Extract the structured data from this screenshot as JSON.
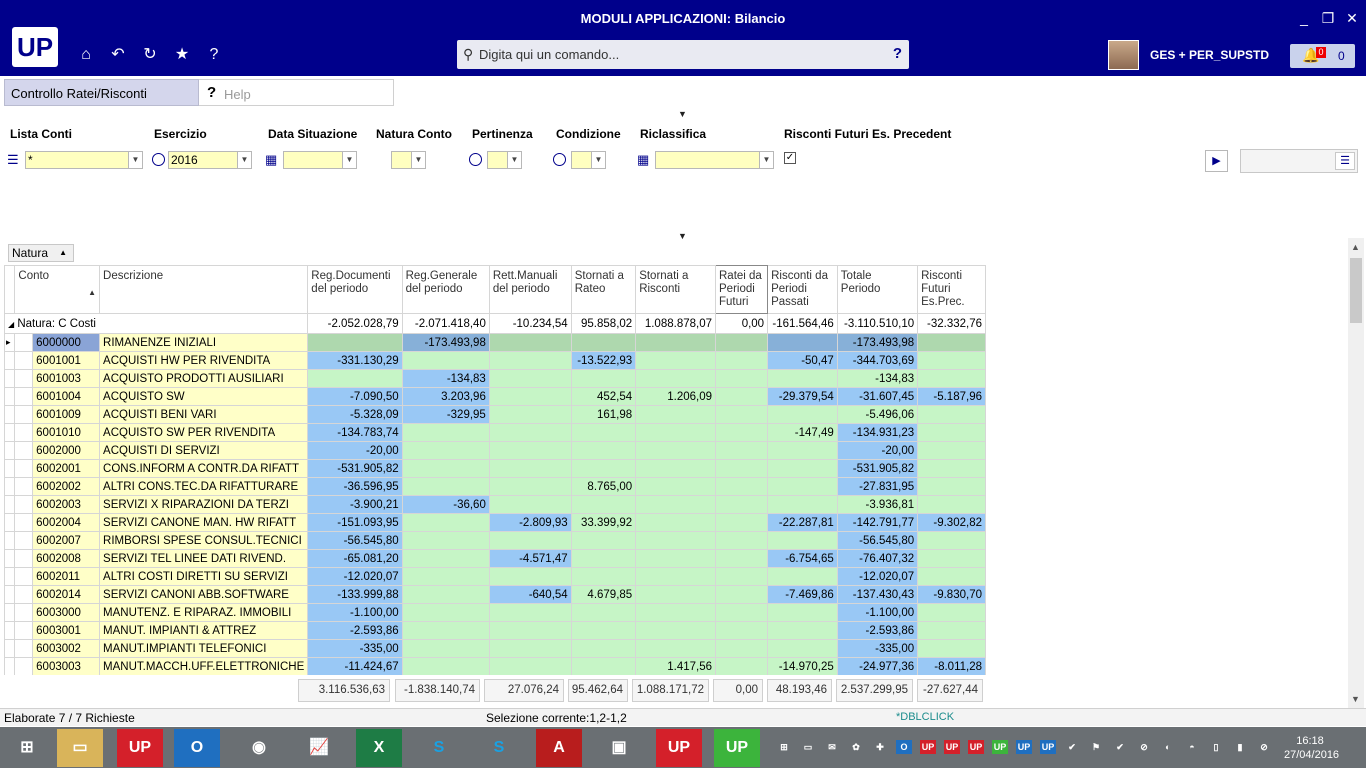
{
  "window": {
    "title": "MODULI APPLICAZIONI: Bilancio",
    "min": "_",
    "max": "❐",
    "close": "✕"
  },
  "header": {
    "logo": "UP",
    "search_placeholder": "Digita qui un comando...",
    "help": "?",
    "user": "GES + PER_SUPSTD",
    "notif_badge": "0",
    "notif_count": "0"
  },
  "tabs": [
    {
      "label": "Controllo Ratei/Risconti"
    },
    {
      "label": "Help"
    }
  ],
  "filters": {
    "lista_conti": {
      "label": "Lista Conti",
      "value": "*"
    },
    "esercizio": {
      "label": "Esercizio",
      "value": "2016"
    },
    "data_situazione": {
      "label": "Data Situazione",
      "value": ""
    },
    "natura_conto": {
      "label": "Natura Conto",
      "value": ""
    },
    "pertinenza": {
      "label": "Pertinenza",
      "value": ""
    },
    "condizione": {
      "label": "Condizione",
      "value": ""
    },
    "riclassifica": {
      "label": "Riclassifica",
      "value": ""
    },
    "risconti_futuri": {
      "label": "Risconti Futuri Es. Precedent",
      "checked": "✓"
    }
  },
  "grouping": {
    "label": "Natura"
  },
  "grid": {
    "columns": [
      "Conto",
      "Descrizione",
      "Reg.Documenti del periodo",
      "Reg.Generale del periodo",
      "Rett.Manuali del periodo",
      "Stornati a Rateo",
      "Stornati a Risconti",
      "Ratei da Periodi Futuri",
      "Risconti da Periodi Passati",
      "Totale Periodo",
      "Risconti Futuri Es.Prec."
    ],
    "group_row": {
      "label": "Natura: C Costi",
      "values": [
        "-2.052.028,79",
        "-2.071.418,40",
        "-10.234,54",
        "95.858,02",
        "1.088.878,07",
        "0,00",
        "-161.564,46",
        "-3.110.510,10",
        "-32.332,76"
      ]
    },
    "rows": [
      {
        "conto": "6000000",
        "descr": "RIMANENZE INIZIALI",
        "v": [
          "",
          "-173.493,98",
          "",
          "",
          "",
          "",
          "",
          "-173.493,98",
          ""
        ]
      },
      {
        "conto": "6001001",
        "descr": "ACQUISTI HW PER RIVENDITA",
        "v": [
          "-331.130,29",
          "",
          "",
          "-13.522,93",
          "",
          "",
          "-50,47",
          "-344.703,69",
          ""
        ]
      },
      {
        "conto": "6001003",
        "descr": "ACQUISTO PRODOTTI AUSILIARI",
        "v": [
          "",
          "-134,83",
          "",
          "",
          "",
          "",
          "",
          "-134,83",
          ""
        ]
      },
      {
        "conto": "6001004",
        "descr": "ACQUISTO SW",
        "v": [
          "-7.090,50",
          "3.203,96",
          "",
          "452,54",
          "1.206,09",
          "",
          "-29.379,54",
          "-31.607,45",
          "-5.187,96"
        ]
      },
      {
        "conto": "6001009",
        "descr": "ACQUISTI BENI VARI",
        "v": [
          "-5.328,09",
          "-329,95",
          "",
          "161,98",
          "",
          "",
          "",
          "-5.496,06",
          ""
        ]
      },
      {
        "conto": "6001010",
        "descr": "ACQUISTO SW PER RIVENDITA",
        "v": [
          "-134.783,74",
          "",
          "",
          "",
          "",
          "",
          "-147,49",
          "-134.931,23",
          ""
        ]
      },
      {
        "conto": "6002000",
        "descr": "ACQUISTI DI SERVIZI",
        "v": [
          "-20,00",
          "",
          "",
          "",
          "",
          "",
          "",
          "-20,00",
          ""
        ]
      },
      {
        "conto": "6002001",
        "descr": "CONS.INFORM A CONTR.DA RIFATT",
        "v": [
          "-531.905,82",
          "",
          "",
          "",
          "",
          "",
          "",
          "-531.905,82",
          ""
        ]
      },
      {
        "conto": "6002002",
        "descr": "ALTRI CONS.TEC.DA RIFATTURARE",
        "v": [
          "-36.596,95",
          "",
          "",
          "8.765,00",
          "",
          "",
          "",
          "-27.831,95",
          ""
        ]
      },
      {
        "conto": "6002003",
        "descr": "SERVIZI X RIPARAZIONI DA TERZI",
        "v": [
          "-3.900,21",
          "-36,60",
          "",
          "",
          "",
          "",
          "",
          "-3.936,81",
          ""
        ]
      },
      {
        "conto": "6002004",
        "descr": "SERVIZI CANONE MAN. HW RIFATT",
        "v": [
          "-151.093,95",
          "",
          "-2.809,93",
          "33.399,92",
          "",
          "",
          "-22.287,81",
          "-142.791,77",
          "-9.302,82"
        ]
      },
      {
        "conto": "6002007",
        "descr": "RIMBORSI SPESE CONSUL.TECNICI",
        "v": [
          "-56.545,80",
          "",
          "",
          "",
          "",
          "",
          "",
          "-56.545,80",
          ""
        ]
      },
      {
        "conto": "6002008",
        "descr": "SERVIZI TEL LINEE DATI RIVEND.",
        "v": [
          "-65.081,20",
          "",
          "-4.571,47",
          "",
          "",
          "",
          "-6.754,65",
          "-76.407,32",
          ""
        ]
      },
      {
        "conto": "6002011",
        "descr": "ALTRI COSTI DIRETTI SU SERVIZI",
        "v": [
          "-12.020,07",
          "",
          "",
          "",
          "",
          "",
          "",
          "-12.020,07",
          ""
        ]
      },
      {
        "conto": "6002014",
        "descr": "SERVIZI CANONI ABB.SOFTWARE",
        "v": [
          "-133.999,88",
          "",
          "-640,54",
          "4.679,85",
          "",
          "",
          "-7.469,86",
          "-137.430,43",
          "-9.830,70"
        ]
      },
      {
        "conto": "6003000",
        "descr": "MANUTENZ. E RIPARAZ. IMMOBILI",
        "v": [
          "-1.100,00",
          "",
          "",
          "",
          "",
          "",
          "",
          "-1.100,00",
          ""
        ]
      },
      {
        "conto": "6003001",
        "descr": "MANUT. IMPIANTI & ATTREZ",
        "v": [
          "-2.593,86",
          "",
          "",
          "",
          "",
          "",
          "",
          "-2.593,86",
          ""
        ]
      },
      {
        "conto": "6003002",
        "descr": "MANUT.IMPIANTI TELEFONICI",
        "v": [
          "-335,00",
          "",
          "",
          "",
          "",
          "",
          "",
          "-335,00",
          ""
        ]
      },
      {
        "conto": "6003003",
        "descr": "MANUT.MACCH.UFF.ELETTRONICHE",
        "v": [
          "-11.424,67",
          "",
          "",
          "",
          "1.417,56",
          "",
          "-14.970,25",
          "-24.977,36",
          "-8.011,28"
        ]
      }
    ],
    "footer": [
      "3.116.536,63",
      "-1.838.140,74",
      "27.076,24",
      "95.462,64",
      "1.088.171,72",
      "0,00",
      "48.193,46",
      "2.537.299,95",
      "-27.627,44"
    ]
  },
  "status": {
    "left": "Elaborate 7 / 7 Richieste",
    "middle": "Selezione corrente:1,2-1,2",
    "right": "*DBLCLICK"
  },
  "taskbar": {
    "time": "16:18",
    "date": "27/04/2016"
  }
}
